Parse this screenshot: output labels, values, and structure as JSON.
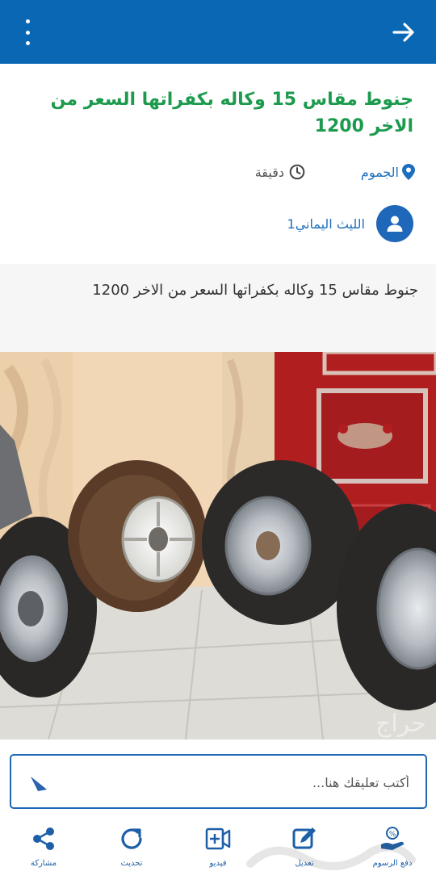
{
  "topbar": {
    "menu_icon": "more-vertical-icon",
    "back_icon": "arrow-right-icon",
    "color": "#0a67b4"
  },
  "listing": {
    "title": "جنوط مقاس 15 وكاله بكفراتها السعر من الاخر 1200",
    "location": "الجموم",
    "time": "دقيقة",
    "username": "الليث اليماني1",
    "description": "جنوط مقاس 15 وكاله بكفراتها السعر من الاخر 1200",
    "title_color": "#1c9a4d",
    "link_color": "#1d6fbd"
  },
  "comment": {
    "placeholder": "أكتب تعليقك هنا..."
  },
  "bottom_nav": {
    "pay_fees": "دفع الرسوم",
    "edit": "تعديل",
    "video": "فيديو",
    "refresh": "تحديث",
    "share": "مشاركة"
  }
}
